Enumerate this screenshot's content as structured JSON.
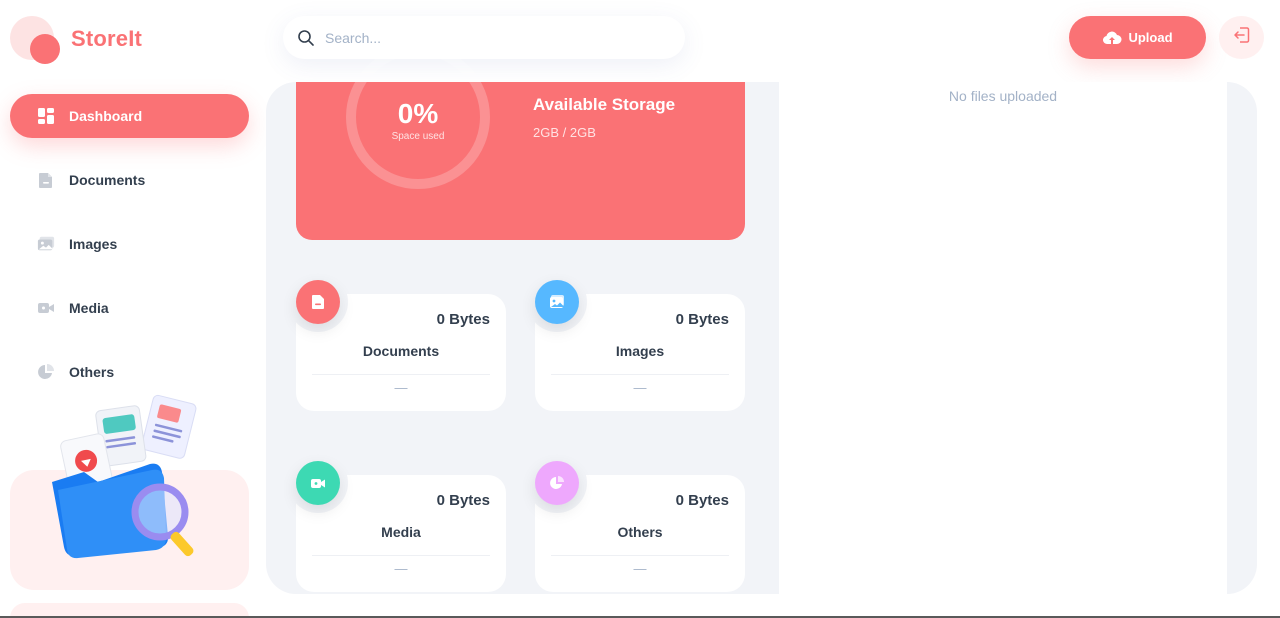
{
  "app": {
    "name": "StoreIt"
  },
  "colors": {
    "brand": "#fa7275",
    "brand_light": "#fff0f0",
    "text": "#333f4e",
    "muted": "#a3b2c7",
    "panel": "#f2f4f8"
  },
  "sidebar": {
    "items": [
      {
        "label": "Dashboard",
        "icon": "dashboard-icon",
        "active": true
      },
      {
        "label": "Documents",
        "icon": "document-icon",
        "active": false
      },
      {
        "label": "Images",
        "icon": "image-icon",
        "active": false
      },
      {
        "label": "Media",
        "icon": "video-icon",
        "active": false
      },
      {
        "label": "Others",
        "icon": "pie-chart-icon",
        "active": false
      }
    ]
  },
  "header": {
    "search_placeholder": "Search...",
    "upload_label": "Upload",
    "upload_icon": "cloud-upload-icon",
    "logout_icon": "logout-icon"
  },
  "storage": {
    "percent_text": "0%",
    "percent_value": 0,
    "percent_caption": "Space used",
    "title": "Available Storage",
    "value": "2GB / 2GB"
  },
  "categories": [
    {
      "title": "Documents",
      "size": "0 Bytes",
      "updated": "—",
      "icon": "document-icon",
      "color": "#fa7275"
    },
    {
      "title": "Images",
      "size": "0 Bytes",
      "updated": "—",
      "icon": "image-icon",
      "color": "#56b8ff"
    },
    {
      "title": "Media",
      "size": "0 Bytes",
      "updated": "—",
      "icon": "video-icon",
      "color": "#3dd9b3"
    },
    {
      "title": "Others",
      "size": "0 Bytes",
      "updated": "—",
      "icon": "pie-chart-icon",
      "color": "#eea8fd"
    }
  ],
  "recent": {
    "empty_text": "No files uploaded"
  }
}
